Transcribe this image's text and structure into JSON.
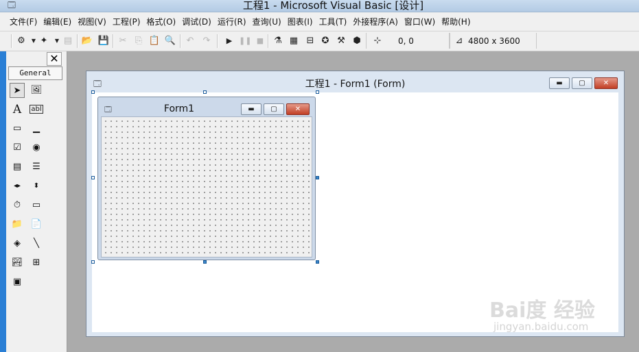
{
  "app": {
    "title": "工程1 - Microsoft Visual Basic [设计]"
  },
  "menu": {
    "items": [
      "文件(F)",
      "编辑(E)",
      "视图(V)",
      "工程(P)",
      "格式(O)",
      "调试(D)",
      "运行(R)",
      "查询(U)",
      "图表(I)",
      "工具(T)",
      "外接程序(A)",
      "窗口(W)",
      "帮助(H)"
    ]
  },
  "toolbar": {
    "position": "0, 0",
    "size": "4800 x 3600"
  },
  "toolbox": {
    "tab": "General",
    "close_glyph": "✕",
    "label_tool_glyph": "A",
    "textbox_tool_glyph": "abl"
  },
  "designer": {
    "title": "工程1 - Form1 (Form)"
  },
  "form": {
    "caption": "Form1"
  },
  "watermark": {
    "main": "Bai度 经验",
    "sub": "jingyan.baidu.com"
  },
  "colors": {
    "title_gradient_top": "#c9dcef",
    "workspace": "#ababab",
    "close_button": "#c23e24",
    "selection_handle": "#3b86c9"
  }
}
